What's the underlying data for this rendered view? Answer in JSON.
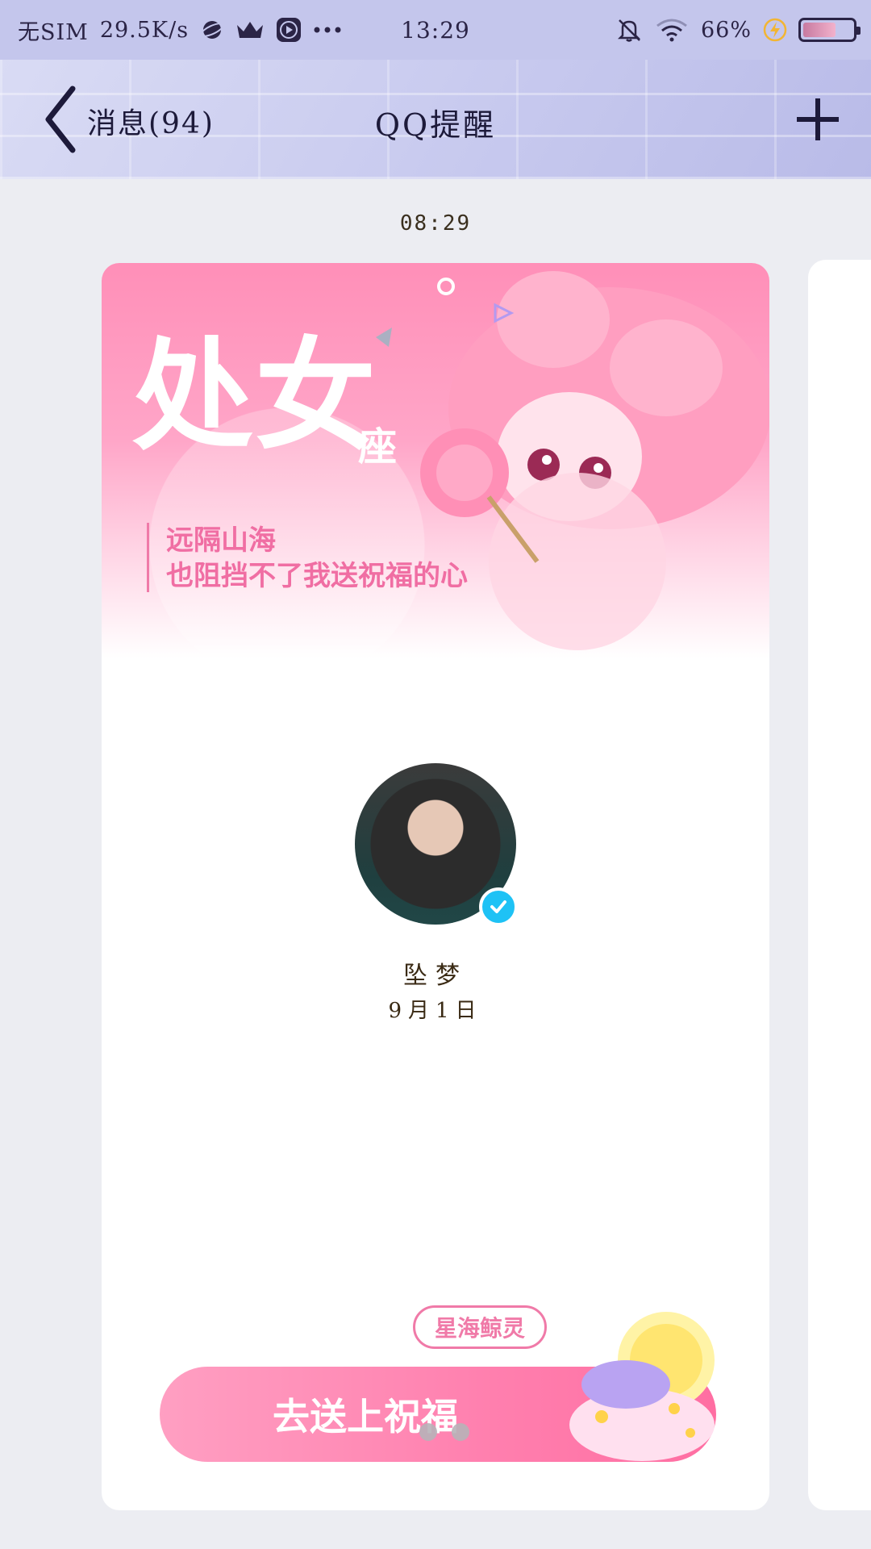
{
  "status_bar": {
    "sim": "无SIM",
    "speed": "29.5K/s",
    "time": "13:29",
    "battery_pct": "66%",
    "battery_level": 0.66,
    "icons": [
      "planet-icon",
      "crown-icon",
      "play-icon",
      "more-dots-icon",
      "mute-icon",
      "wifi-icon",
      "charging-icon",
      "battery-icon"
    ]
  },
  "nav": {
    "back_label": "消息(94)",
    "title": "QQ提醒",
    "add_icon": "plus-icon"
  },
  "message": {
    "timestamp": "08:29"
  },
  "card": {
    "banner_title": "处女",
    "banner_title_suffix": "座",
    "banner_line1": "远隔山海",
    "banner_line2": "也阻挡不了我送祝福的心",
    "user_name": "坠梦",
    "birthday": "9月1日",
    "tag": "星海鲸灵",
    "cta_label": "去送上祝福",
    "pager_count": 2
  },
  "colors": {
    "status_bg": "#C4C6EC",
    "page_bg": "#ECEDF2",
    "accent_pink": "#F07AA8",
    "verified_blue": "#1EC2F5"
  }
}
